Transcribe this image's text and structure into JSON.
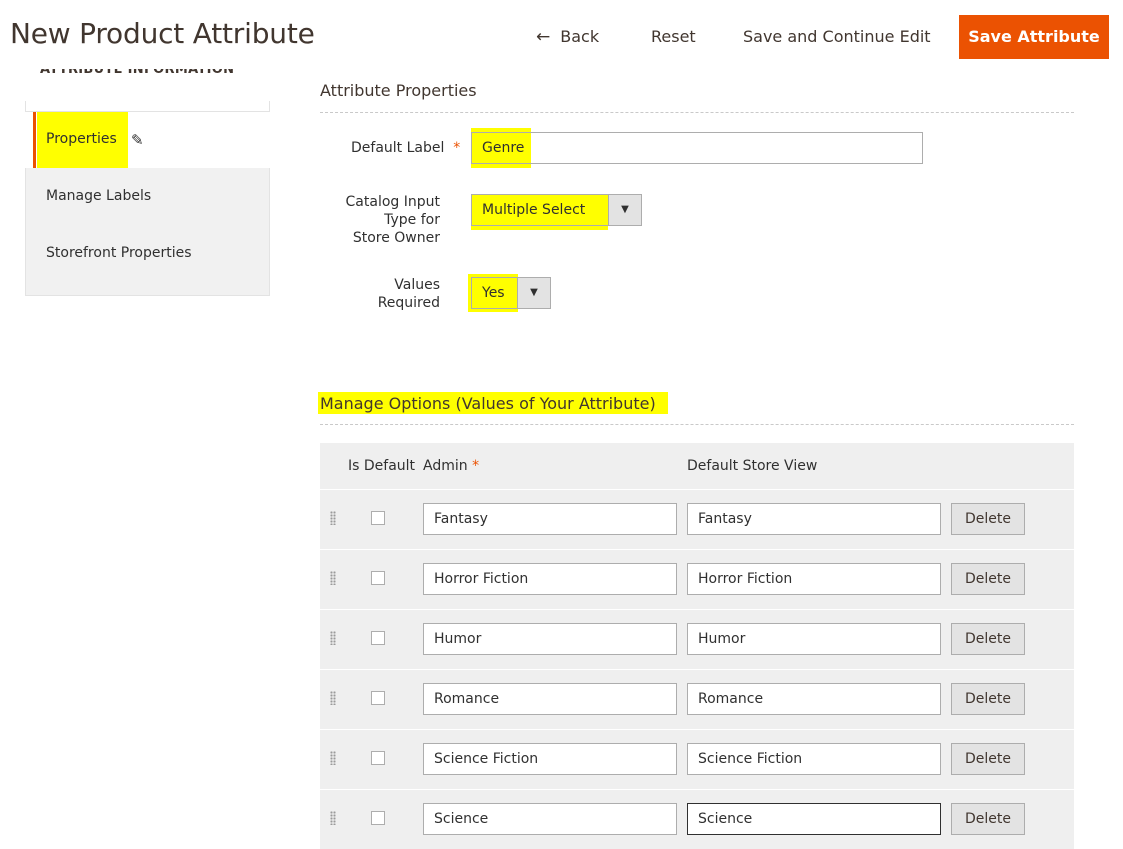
{
  "header": {
    "title": "New Product Attribute",
    "back_label": "Back",
    "reset_label": "Reset",
    "save_continue_label": "Save and Continue Edit",
    "save_label": "Save Attribute"
  },
  "sidebar": {
    "section_title": "ATTRIBUTE INFORMATION",
    "items": [
      {
        "label": "Properties",
        "active": true
      },
      {
        "label": "Manage Labels"
      },
      {
        "label": "Storefront Properties"
      }
    ]
  },
  "attribute_properties": {
    "title": "Attribute Properties",
    "default_label": {
      "label": "Default Label",
      "required_mark": "*",
      "value": "Genre"
    },
    "input_type": {
      "label_lines": [
        "Catalog Input",
        "Type for",
        "Store Owner"
      ],
      "value": "Multiple Select"
    },
    "values_required": {
      "label_lines": [
        "Values",
        "Required"
      ],
      "value": "Yes"
    }
  },
  "manage_options": {
    "title": "Manage Options (Values of Your Attribute)",
    "columns": {
      "is_default": "Is Default",
      "admin": "Admin",
      "admin_required": "*",
      "store_view": "Default Store View"
    },
    "delete_label": "Delete",
    "rows": [
      {
        "admin": "Fantasy",
        "store": "Fantasy"
      },
      {
        "admin": "Horror Fiction",
        "store": "Horror Fiction"
      },
      {
        "admin": "Humor",
        "store": "Humor"
      },
      {
        "admin": "Romance",
        "store": "Romance"
      },
      {
        "admin": "Science Fiction",
        "store": "Science Fiction"
      },
      {
        "admin": "Science",
        "store": "Science"
      }
    ]
  },
  "colors": {
    "accent": "#eb5202",
    "highlight": "#ffff00"
  }
}
